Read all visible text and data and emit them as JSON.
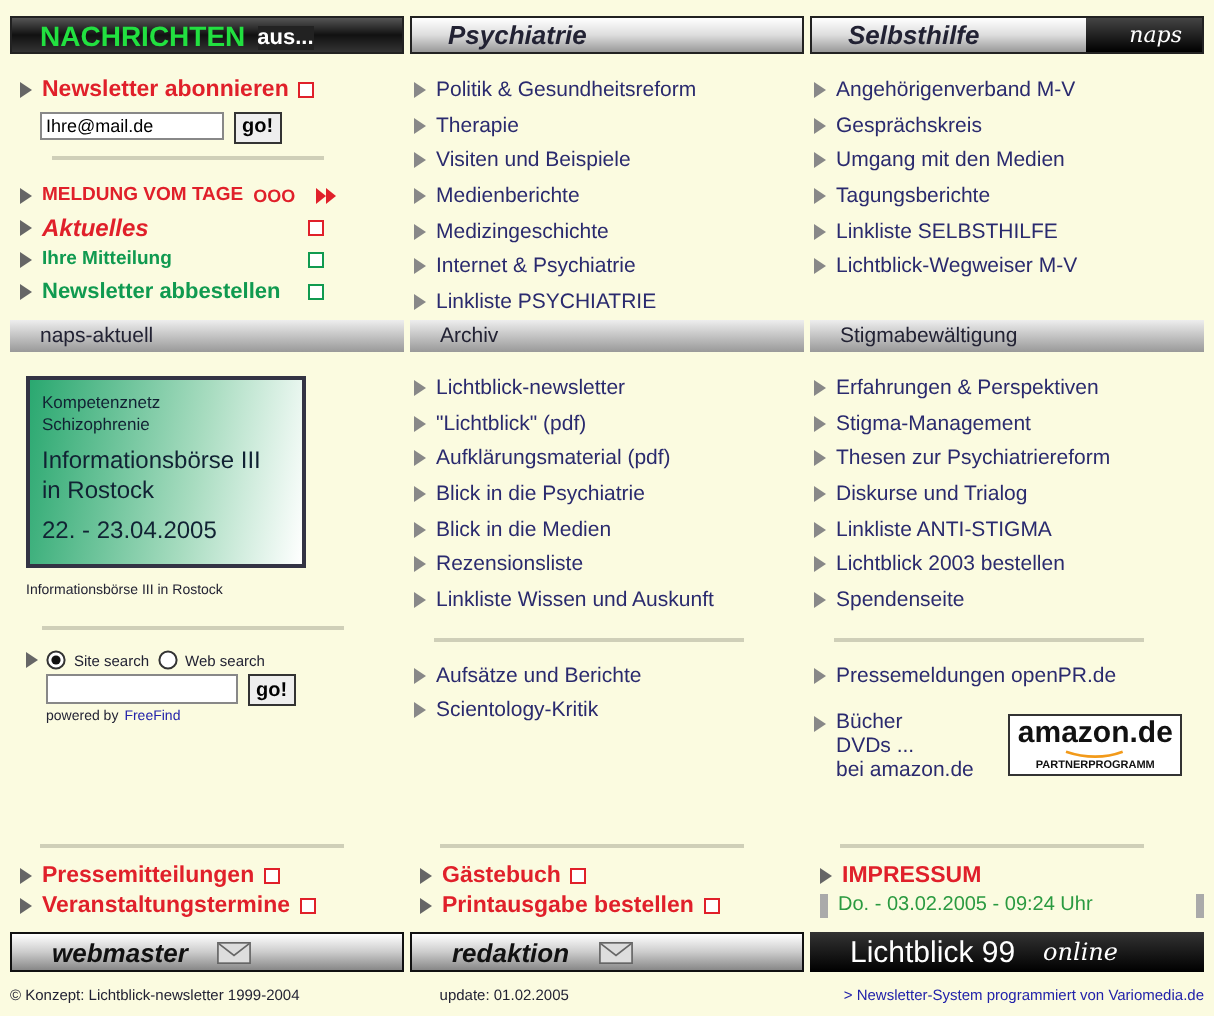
{
  "header": [
    {
      "kind": "dark",
      "label": "NACHRICHTEN",
      "suffix": "aus..."
    },
    {
      "kind": "light",
      "label": "Psychiatrie"
    },
    {
      "kind": "light",
      "label": "Selbsthilfe",
      "badge": "naps"
    }
  ],
  "newsletter": {
    "label": "Newsletter abonnieren",
    "email_value": "Ihre@mail.de",
    "button": "go!"
  },
  "news_items": [
    {
      "label": "MELDUNG VOM TAGE",
      "kind": "caps",
      "color": "#e0202a",
      "trail": "OOO"
    },
    {
      "label": "Aktuelles",
      "kind": "italic",
      "color": "#e0202a"
    },
    {
      "label": "Ihre Mitteilung",
      "kind": "small",
      "color": "#109a50"
    },
    {
      "label": "Newsletter abbestellen",
      "kind": "bold",
      "color": "#109a50"
    }
  ],
  "psychiatrie": [
    "Politik & Gesundheitsreform",
    "Therapie",
    "Visiten und Beispiele",
    "Medienberichte",
    "Medizingeschichte",
    "Internet & Psychiatrie",
    "Linkliste PSYCHIATRIE"
  ],
  "selbsthilfe": [
    "Angehörigenverband M-V",
    "Gesprächskreis",
    "Umgang mit den Medien",
    "Tagungsberichte",
    "Linkliste SELBSTHILFE",
    "Lichtblick-Wegweiser M-V"
  ],
  "sections": [
    "naps-aktuell",
    "Archiv",
    "Stigmabewältigung"
  ],
  "banner": {
    "lines_small": [
      "Kompetenznetz",
      "Schizophrenie"
    ],
    "title_lines": [
      "Informationsbörse III",
      "in Rostock"
    ],
    "date": "22. - 23.04.2005",
    "caption": "Informationsbörse III in Rostock"
  },
  "search": {
    "options": [
      {
        "label": "Site search",
        "selected": true
      },
      {
        "label": "Web search",
        "selected": false
      }
    ],
    "button": "go!",
    "powered_by": "powered by",
    "provider": "FreeFind"
  },
  "archiv": [
    "Lichtblick-newsletter",
    "\"Lichtblick\" (pdf)",
    "Aufklärungsmaterial (pdf)",
    "Blick in die Psychiatrie",
    "Blick in die Medien",
    "Rezensionsliste",
    "Linkliste Wissen und Auskunft"
  ],
  "archiv_more": [
    "Aufsätze und Berichte",
    "Scientology-Kritik"
  ],
  "stigma": [
    "Erfahrungen & Perspektiven",
    "Stigma-Management",
    "Thesen zur Psychiatriereform",
    "Diskurse und Trialog",
    "Linkliste ANTI-STIGMA",
    "Lichtblick 2003 bestellen",
    "Spendenseite"
  ],
  "stigma_more": [
    "Pressemeldungen openPR.de"
  ],
  "amazon": {
    "lines": [
      "Bücher",
      "DVDs ...",
      "bei amazon.de"
    ],
    "logo": "amazon.de",
    "logo_sub": "PARTNERPROGRAMM"
  },
  "bottom_links": [
    [
      "Pressemitteilungen",
      "Veranstaltungstermine"
    ],
    [
      "Gästebuch",
      "Printausgabe bestellen"
    ]
  ],
  "impressum": "IMPRESSUM",
  "date_line": "Do. - 03.02.2005 - 09:24 Uhr",
  "bar": [
    {
      "label": "webmaster",
      "kind": "mail"
    },
    {
      "label": "redaktion",
      "kind": "mail"
    }
  ],
  "brand": {
    "label": "Lichtblick 99",
    "suffix": "online"
  },
  "footer": {
    "left": "© Konzept: Lichtblick-newsletter 1999-2004",
    "center": "update: 01.02.2005",
    "right": "> Newsletter-System programmiert von Variomedia.de"
  }
}
